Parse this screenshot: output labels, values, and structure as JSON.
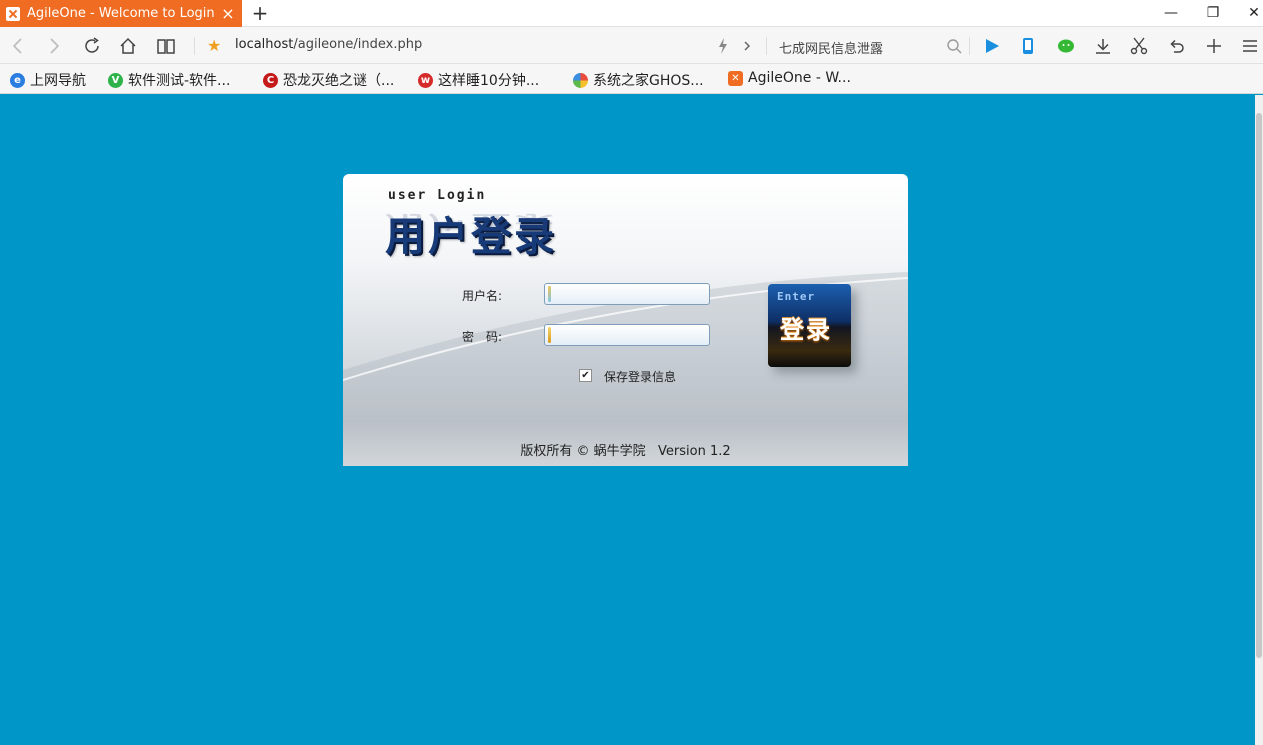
{
  "browser": {
    "tab_title": "AgileOne - Welcome to Login",
    "tab_close": "×",
    "new_tab": "+",
    "window": {
      "minimize": "—",
      "restore": "❐",
      "close": "✕"
    },
    "url_host": "localhost",
    "url_path": "/agileone/index.php",
    "search_placeholder": "七成网民信息泄露"
  },
  "bookmarks": [
    {
      "label": "上网导航",
      "icon": "e-icon",
      "color": "#2a7de1"
    },
    {
      "label": "软件测试-软件...",
      "icon": "v-icon",
      "color": "#2db34a"
    },
    {
      "label": "恐龙灭绝之谜（...",
      "icon": "c-icon",
      "color": "#c41a1a"
    },
    {
      "label": "这样睡10分钟...",
      "icon": "weibo-icon",
      "color": "#d62b2b"
    },
    {
      "label": "系统之家GHOS...",
      "icon": "pinwheel-icon",
      "color": "#7ab648"
    },
    {
      "label": "AgileOne - W...",
      "icon": "agileone-icon",
      "color": "#ef6c22"
    }
  ],
  "login": {
    "header_en": "user Login",
    "header_zh": "用户登录",
    "username_label": "用户名:",
    "password_label": "密　码:",
    "remember_checked": true,
    "remember_label": "保存登录信息",
    "enter_en": "Enter",
    "enter_zh": "登录",
    "footer": "版权所有 © 蜗牛学院   Version 1.2"
  }
}
